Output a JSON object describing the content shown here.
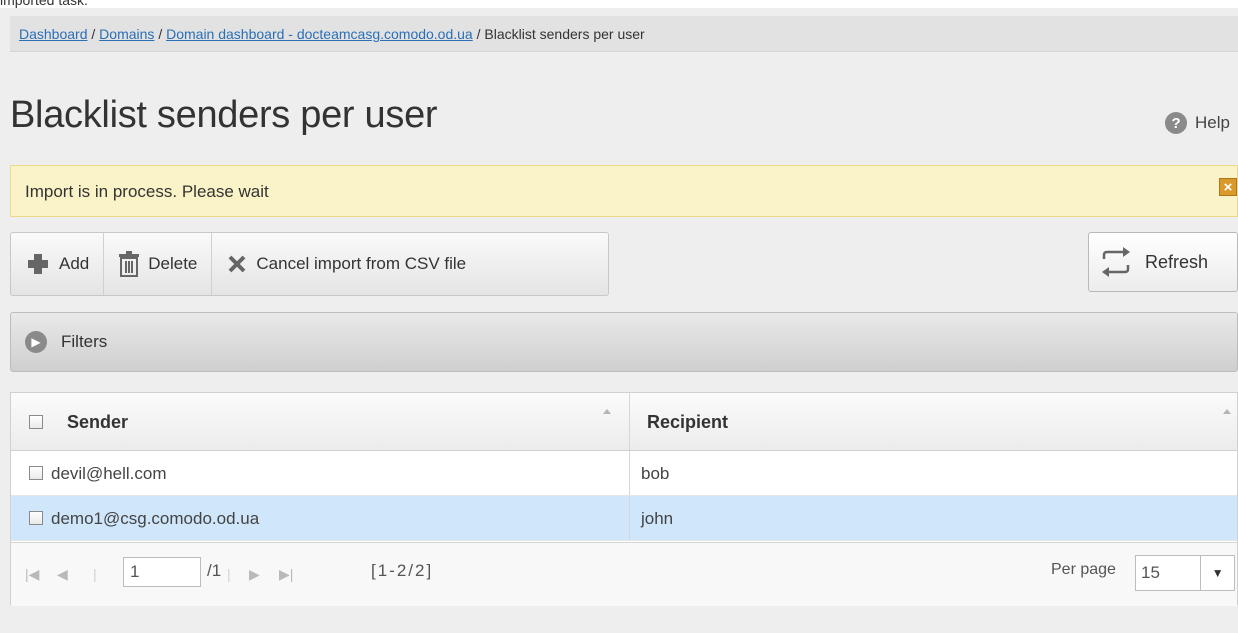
{
  "caption": "imported task.",
  "breadcrumb": {
    "items": [
      "Dashboard",
      "Domains",
      "Domain dashboard - docteamcasg.comodo.od.ua"
    ],
    "current": "Blacklist senders per user",
    "separator": "/"
  },
  "page_title": "Blacklist senders per user",
  "help_label": "Help",
  "alert": {
    "message": "Import is in process. Please wait"
  },
  "toolbar": {
    "add_label": "Add",
    "delete_label": "Delete",
    "cancel_import_label": "Cancel import from CSV file",
    "refresh_label": "Refresh"
  },
  "filters_label": "Filters",
  "table": {
    "headers": [
      "Sender",
      "Recipient"
    ],
    "rows": [
      {
        "sender": "devil@hell.com",
        "recipient": "bob",
        "selected": false
      },
      {
        "sender": "demo1@csg.comodo.od.ua",
        "recipient": "john",
        "selected": true
      }
    ]
  },
  "pager": {
    "page": "1",
    "total_pages": "/1",
    "range": "[1-2/2]",
    "per_page_label": "Per page",
    "per_page_value": "15"
  },
  "colors": {
    "alert_bg": "#fbf3c8",
    "selected_row": "#cfe6fb",
    "link": "#2a6fb7"
  }
}
